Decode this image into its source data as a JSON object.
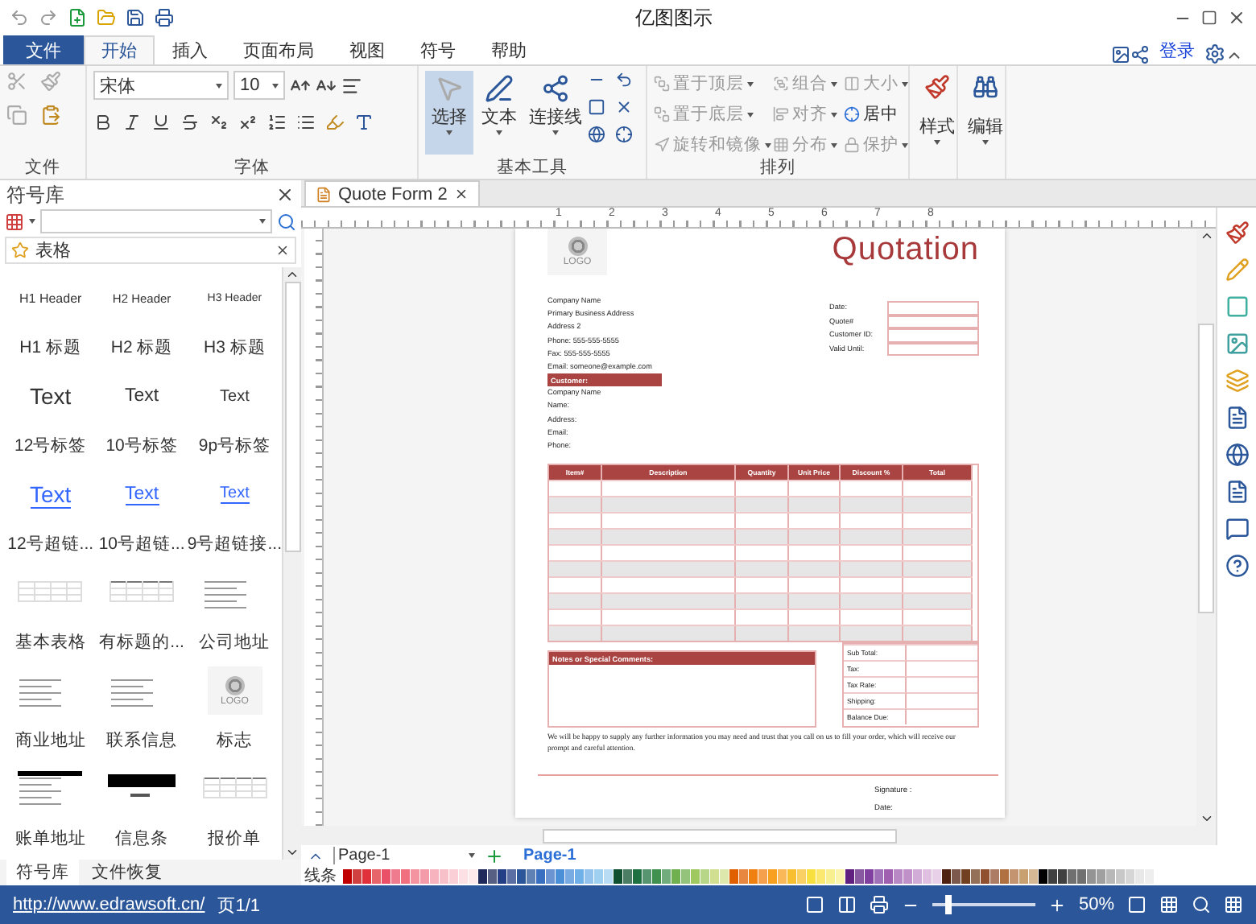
{
  "window": {
    "title": "亿图图示"
  },
  "ribbon": {
    "file_tab": "文件",
    "login": "登录",
    "tabs": [
      {
        "label": "开始",
        "selected": true
      },
      {
        "label": "插入",
        "selected": false
      },
      {
        "label": "页面布局",
        "selected": false
      },
      {
        "label": "视图",
        "selected": false
      },
      {
        "label": "符号",
        "selected": false
      },
      {
        "label": "帮助",
        "selected": false
      }
    ],
    "file_group": {
      "label": "文件"
    },
    "font_group": {
      "label": "字体",
      "font_name": "宋体",
      "font_size": "10"
    },
    "tools_group": {
      "label": "基本工具",
      "buttons": [
        {
          "label": "选择",
          "selected": true
        },
        {
          "label": "文本",
          "selected": false
        },
        {
          "label": "连接线",
          "selected": false
        }
      ]
    },
    "arrange_group": {
      "label": "排列",
      "items": [
        {
          "label": "置于顶层",
          "disabled": true,
          "dropdown": true
        },
        {
          "label": "组合",
          "disabled": true,
          "dropdown": true
        },
        {
          "label": "大小",
          "disabled": true,
          "dropdown": true
        },
        {
          "label": "置于底层",
          "disabled": true,
          "dropdown": true
        },
        {
          "label": "对齐",
          "disabled": true,
          "dropdown": true
        },
        {
          "label": "居中",
          "disabled": false,
          "dropdown": false
        },
        {
          "label": "旋转和镜像",
          "disabled": true,
          "dropdown": true
        },
        {
          "label": "分布",
          "disabled": true,
          "dropdown": true
        },
        {
          "label": "保护",
          "disabled": true,
          "dropdown": true
        }
      ]
    },
    "style_group": {
      "label": "样式"
    },
    "edit_group": {
      "label": "编辑"
    }
  },
  "library": {
    "title": "符号库",
    "category": "表格",
    "items": [
      {
        "kind": "header",
        "text": "H1 Header"
      },
      {
        "kind": "header",
        "text": "H2 Header"
      },
      {
        "kind": "header",
        "text": "H3 Header"
      },
      {
        "kind": "caption",
        "text": "H1 标题"
      },
      {
        "kind": "caption",
        "text": "H2 标题"
      },
      {
        "kind": "caption",
        "text": "H3 标题"
      },
      {
        "kind": "text",
        "text": "Text"
      },
      {
        "kind": "text",
        "text": "Text"
      },
      {
        "kind": "text",
        "text": "Text"
      },
      {
        "kind": "caption",
        "text": "12号标签"
      },
      {
        "kind": "caption",
        "text": "10号标签"
      },
      {
        "kind": "caption",
        "text": "9p号标签"
      },
      {
        "kind": "link",
        "text": "Text"
      },
      {
        "kind": "link",
        "text": "Text"
      },
      {
        "kind": "link",
        "text": "Text"
      },
      {
        "kind": "caption",
        "text": "12号超链..."
      },
      {
        "kind": "caption",
        "text": "10号超链..."
      },
      {
        "kind": "caption",
        "text": "9号超链接..."
      },
      {
        "kind": "table"
      },
      {
        "kind": "titled-table"
      },
      {
        "kind": "address"
      },
      {
        "kind": "caption",
        "text": "基本表格"
      },
      {
        "kind": "caption",
        "text": "有标题的..."
      },
      {
        "kind": "caption",
        "text": "公司地址"
      },
      {
        "kind": "address"
      },
      {
        "kind": "contact"
      },
      {
        "kind": "logo",
        "text": "LOGO"
      },
      {
        "kind": "caption",
        "text": "商业地址"
      },
      {
        "kind": "caption",
        "text": "联系信息"
      },
      {
        "kind": "caption",
        "text": "标志"
      },
      {
        "kind": "bill"
      },
      {
        "kind": "bar"
      },
      {
        "kind": "titled-table"
      },
      {
        "kind": "caption",
        "text": "账单地址"
      },
      {
        "kind": "caption",
        "text": "信息条"
      },
      {
        "kind": "caption",
        "text": "报价单"
      }
    ],
    "tabs": [
      {
        "label": "符号库",
        "selected": true
      },
      {
        "label": "文件恢复",
        "selected": false
      }
    ]
  },
  "canvas": {
    "tab": "Quote Form 2",
    "ruler_marks": [
      "1",
      "2",
      "3",
      "4",
      "5",
      "6",
      "7",
      "8"
    ]
  },
  "document": {
    "logo": "LOGO",
    "title": "Quotation",
    "company_lines": [
      "Company Name",
      "Primary Business Address",
      "Address 2",
      "Phone: 555-555-5555",
      "Fax: 555-555-5555",
      "Email: someone@example.com"
    ],
    "info_labels": [
      "Date:",
      "Quote#",
      "Customer ID:",
      "Valid Until:"
    ],
    "customer_heading": "Customer:",
    "customer_lines": [
      "Company Name",
      "Name:",
      "Address:",
      "Email:",
      "Phone:"
    ],
    "columns": [
      "Item#",
      "Description",
      "Quantity",
      "Unit Price",
      "Discount %",
      "Total"
    ],
    "rows": [
      {
        "shaded": false
      },
      {
        "shaded": true
      },
      {
        "shaded": false
      },
      {
        "shaded": true
      },
      {
        "shaded": false
      },
      {
        "shaded": true
      },
      {
        "shaded": false
      },
      {
        "shaded": true
      },
      {
        "shaded": false
      },
      {
        "shaded": true
      }
    ],
    "notes_heading": "Notes or Special Comments:",
    "totals": [
      "Sub Total:",
      "Tax:",
      "Tax Rate:",
      "Shipping:",
      "Balance Due:"
    ],
    "closing": "We will be happy to supply any further information you may need and trust that you call on us to fill your order, which will receive our prompt and careful attention.",
    "signature": "Signature :",
    "date": "Date:"
  },
  "pages": {
    "select": "Page-1",
    "tabs": [
      {
        "label": "Page-1",
        "selected": true
      }
    ]
  },
  "palette": {
    "label": "线条"
  },
  "status_bar": {
    "link": "http://www.edrawsoft.cn/",
    "page": "页1/1",
    "zoom": "50%",
    "zoom_slider": {
      "level": 0.15
    }
  }
}
